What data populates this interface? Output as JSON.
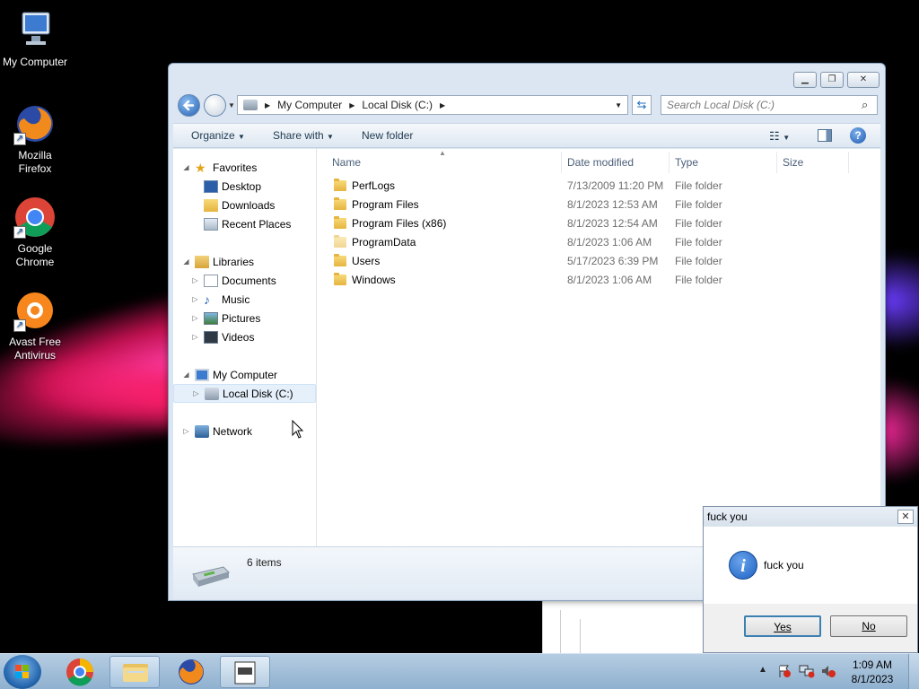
{
  "desktop": {
    "icons": [
      {
        "label": "My Computer"
      },
      {
        "label": "Mozilla\nFirefox"
      },
      {
        "label": "Google\nChrome"
      },
      {
        "label": "Avast Free\nAntivirus"
      }
    ]
  },
  "explorer": {
    "breadcrumb": [
      "My Computer",
      "Local Disk (C:)"
    ],
    "search_placeholder": "Search Local Disk (C:)",
    "toolbar": {
      "organize": "Organize",
      "share_with": "Share with",
      "new_folder": "New folder"
    },
    "nav": {
      "favorites": "Favorites",
      "favorites_items": [
        "Desktop",
        "Downloads",
        "Recent Places"
      ],
      "libraries": "Libraries",
      "libraries_items": [
        "Documents",
        "Music",
        "Pictures",
        "Videos"
      ],
      "computer": "My Computer",
      "computer_items": [
        "Local Disk (C:)"
      ],
      "network": "Network"
    },
    "columns": {
      "name": "Name",
      "date": "Date modified",
      "type": "Type",
      "size": "Size"
    },
    "files": [
      {
        "name": "PerfLogs",
        "date": "7/13/2009 11:20 PM",
        "type": "File folder"
      },
      {
        "name": "Program Files",
        "date": "8/1/2023 12:53 AM",
        "type": "File folder"
      },
      {
        "name": "Program Files (x86)",
        "date": "8/1/2023 12:54 AM",
        "type": "File folder"
      },
      {
        "name": "ProgramData",
        "date": "8/1/2023 1:06 AM",
        "type": "File folder"
      },
      {
        "name": "Users",
        "date": "5/17/2023 6:39 PM",
        "type": "File folder"
      },
      {
        "name": "Windows",
        "date": "8/1/2023 1:06 AM",
        "type": "File folder"
      }
    ],
    "status": "6 items"
  },
  "dialog": {
    "title": "fuck you",
    "message": "fuck you",
    "yes": "Yes",
    "no": "No"
  },
  "taskbar": {
    "time": "1:09 AM",
    "date": "8/1/2023"
  },
  "colors": {
    "info_icon": "#1c62c4",
    "selection": "#e5f0fb"
  }
}
